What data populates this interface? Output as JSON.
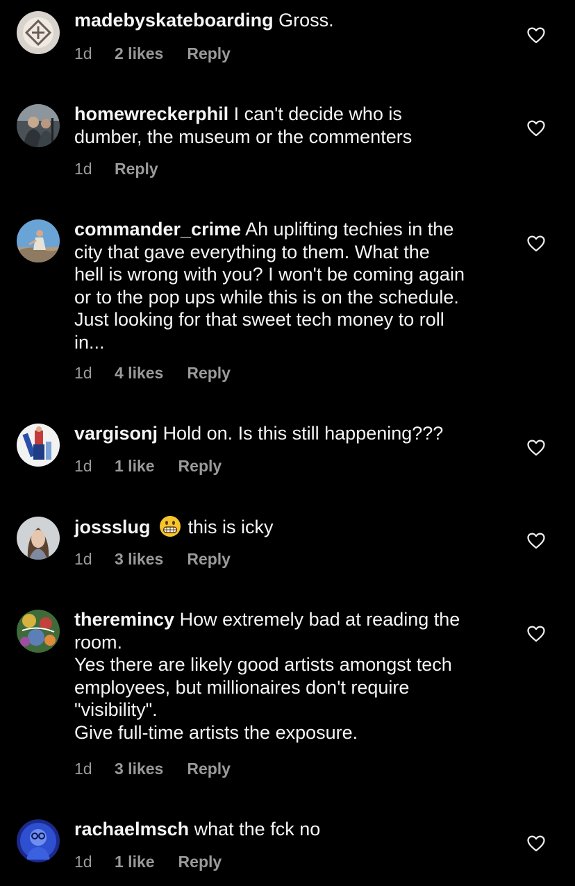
{
  "comments": [
    {
      "username": "madebyskateboarding",
      "lines": [
        "Gross."
      ],
      "time": "1d",
      "likes": "2 likes",
      "reply": "Reply"
    },
    {
      "username": "homewreckerphil",
      "lines": [
        "I can't decide who is",
        "dumber, the museum or the commenters"
      ],
      "time": "1d",
      "likes": "",
      "reply": "Reply"
    },
    {
      "username": "commander_crime",
      "lines": [
        "Ah uplifting techies in the",
        "city that gave everything to them. What the",
        "hell is wrong with you? I won't be coming again",
        "or to the pop ups while this is on the schedule.",
        "Just looking for that sweet tech money to roll",
        "in..."
      ],
      "time": "1d",
      "likes": "4 likes",
      "reply": "Reply"
    },
    {
      "username": "vargisonj",
      "lines": [
        "Hold on. Is this still happening???"
      ],
      "time": "1d",
      "likes": "1 like",
      "reply": "Reply"
    },
    {
      "username": "jossslug",
      "emoji": "grimacing-face",
      "lines": [
        "this is icky"
      ],
      "time": "1d",
      "likes": "3 likes",
      "reply": "Reply"
    },
    {
      "username": "theremincy",
      "lines": [
        "How extremely bad at reading the",
        "room.",
        "Yes there are likely good artists amongst tech",
        "employees, but millionaires don't require",
        "\"visibility\".",
        "Give full-time artists the exposure."
      ],
      "time": "1d",
      "likes": "3 likes",
      "reply": "Reply"
    },
    {
      "username": "rachaelmsch",
      "lines": [
        "what the fck no"
      ],
      "time": "1d",
      "likes": "1 like",
      "reply": "Reply"
    }
  ],
  "icons": {
    "like": "heart-outline-icon",
    "emoji": "grimacing-face-emoji"
  },
  "colors": {
    "background": "#000000",
    "text": "#f5f5f5",
    "meta": "#9a9a9a"
  }
}
